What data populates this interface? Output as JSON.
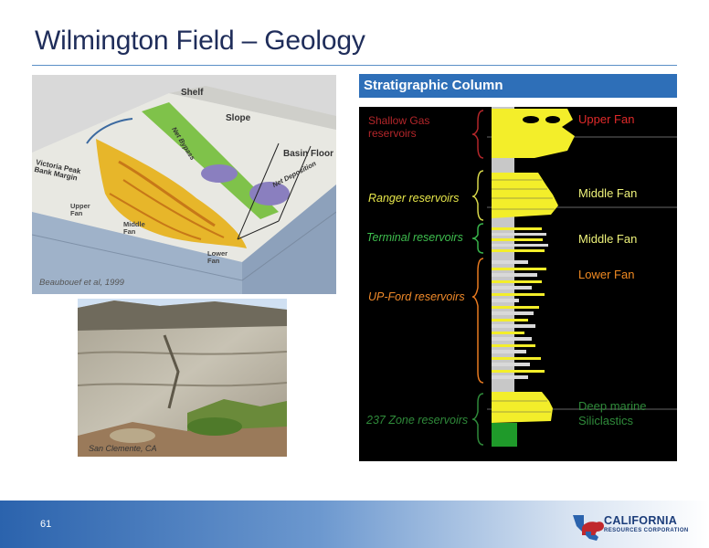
{
  "slide": {
    "title": "Wilmington Field – Geology",
    "page_number": "61"
  },
  "block_diagram": {
    "labels": {
      "shelf": "Shelf",
      "slope": "Slope",
      "basin_floor": "Basin Floor",
      "net_bypass": "Net Bypass",
      "net_deposition": "Net Deposition",
      "victoria": "Victoria Peak\nBank Margin",
      "upper_fan": "Upper\nFan",
      "middle_fan": "Middle\nFan",
      "lower_fan": "Lower\nFan"
    },
    "credit": "Beaubouef et al, 1999"
  },
  "photo": {
    "credit": "San Clemente, CA"
  },
  "strat_column": {
    "header": "Stratigraphic Column",
    "reservoirs": {
      "shallow_gas": "Shallow Gas\nreservoirs",
      "ranger": "Ranger reservoirs",
      "terminal": "Terminal reservoirs",
      "up_ford": "UP-Ford reservoirs",
      "zone237": "237 Zone reservoirs"
    },
    "facies": {
      "upper_fan": "Upper Fan",
      "middle_fan_1": "Middle Fan",
      "middle_fan_2": "Middle Fan",
      "lower_fan": "Lower Fan",
      "deep_marine": "Deep marine\nSiliclastics"
    },
    "colors": {
      "shallow_gas": "#b3262a",
      "ranger": "#d8d84a",
      "terminal": "#38b24a",
      "up_ford": "#e87a20",
      "zone237": "#2f8a3a",
      "upper_fan": "#d42a2a",
      "middle_fan": "#e6f26a",
      "lower_fan": "#e8821e",
      "sand": "#f3ee2a"
    }
  },
  "logo": {
    "name": "CALIFORNIA",
    "sub": "RESOURCES CORPORATION"
  }
}
